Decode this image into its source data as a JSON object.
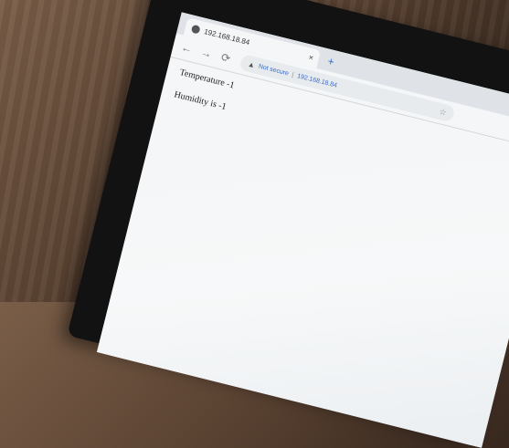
{
  "browser": {
    "tab_title": "192.168.18.84",
    "tab_close": "×",
    "new_tab": "+",
    "nav": {
      "back": "←",
      "forward": "→",
      "reload": "⟳"
    },
    "address": {
      "warning_icon": "▲",
      "security_label": "Not secure",
      "separator": "|",
      "host": "192.168.18.84",
      "bookmark_icon": "☆"
    }
  },
  "page": {
    "temperature": "Temperature -1",
    "humidity": "Humidity is -1"
  }
}
